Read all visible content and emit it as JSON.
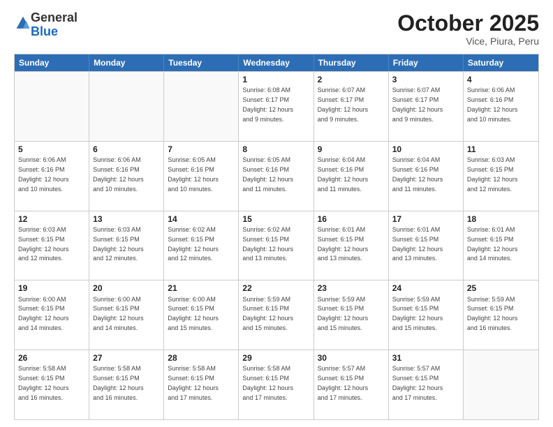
{
  "header": {
    "logo_general": "General",
    "logo_blue": "Blue",
    "month": "October 2025",
    "location": "Vice, Piura, Peru"
  },
  "days_of_week": [
    "Sunday",
    "Monday",
    "Tuesday",
    "Wednesday",
    "Thursday",
    "Friday",
    "Saturday"
  ],
  "weeks": [
    [
      {
        "day": "",
        "empty": true
      },
      {
        "day": "",
        "empty": true
      },
      {
        "day": "",
        "empty": true
      },
      {
        "day": "1",
        "lines": [
          "Sunrise: 6:08 AM",
          "Sunset: 6:17 PM",
          "Daylight: 12 hours",
          "and 9 minutes."
        ]
      },
      {
        "day": "2",
        "lines": [
          "Sunrise: 6:07 AM",
          "Sunset: 6:17 PM",
          "Daylight: 12 hours",
          "and 9 minutes."
        ]
      },
      {
        "day": "3",
        "lines": [
          "Sunrise: 6:07 AM",
          "Sunset: 6:17 PM",
          "Daylight: 12 hours",
          "and 9 minutes."
        ]
      },
      {
        "day": "4",
        "lines": [
          "Sunrise: 6:06 AM",
          "Sunset: 6:16 PM",
          "Daylight: 12 hours",
          "and 10 minutes."
        ]
      }
    ],
    [
      {
        "day": "5",
        "lines": [
          "Sunrise: 6:06 AM",
          "Sunset: 6:16 PM",
          "Daylight: 12 hours",
          "and 10 minutes."
        ]
      },
      {
        "day": "6",
        "lines": [
          "Sunrise: 6:06 AM",
          "Sunset: 6:16 PM",
          "Daylight: 12 hours",
          "and 10 minutes."
        ]
      },
      {
        "day": "7",
        "lines": [
          "Sunrise: 6:05 AM",
          "Sunset: 6:16 PM",
          "Daylight: 12 hours",
          "and 10 minutes."
        ]
      },
      {
        "day": "8",
        "lines": [
          "Sunrise: 6:05 AM",
          "Sunset: 6:16 PM",
          "Daylight: 12 hours",
          "and 11 minutes."
        ]
      },
      {
        "day": "9",
        "lines": [
          "Sunrise: 6:04 AM",
          "Sunset: 6:16 PM",
          "Daylight: 12 hours",
          "and 11 minutes."
        ]
      },
      {
        "day": "10",
        "lines": [
          "Sunrise: 6:04 AM",
          "Sunset: 6:16 PM",
          "Daylight: 12 hours",
          "and 11 minutes."
        ]
      },
      {
        "day": "11",
        "lines": [
          "Sunrise: 6:03 AM",
          "Sunset: 6:15 PM",
          "Daylight: 12 hours",
          "and 12 minutes."
        ]
      }
    ],
    [
      {
        "day": "12",
        "lines": [
          "Sunrise: 6:03 AM",
          "Sunset: 6:15 PM",
          "Daylight: 12 hours",
          "and 12 minutes."
        ]
      },
      {
        "day": "13",
        "lines": [
          "Sunrise: 6:03 AM",
          "Sunset: 6:15 PM",
          "Daylight: 12 hours",
          "and 12 minutes."
        ]
      },
      {
        "day": "14",
        "lines": [
          "Sunrise: 6:02 AM",
          "Sunset: 6:15 PM",
          "Daylight: 12 hours",
          "and 12 minutes."
        ]
      },
      {
        "day": "15",
        "lines": [
          "Sunrise: 6:02 AM",
          "Sunset: 6:15 PM",
          "Daylight: 12 hours",
          "and 13 minutes."
        ]
      },
      {
        "day": "16",
        "lines": [
          "Sunrise: 6:01 AM",
          "Sunset: 6:15 PM",
          "Daylight: 12 hours",
          "and 13 minutes."
        ]
      },
      {
        "day": "17",
        "lines": [
          "Sunrise: 6:01 AM",
          "Sunset: 6:15 PM",
          "Daylight: 12 hours",
          "and 13 minutes."
        ]
      },
      {
        "day": "18",
        "lines": [
          "Sunrise: 6:01 AM",
          "Sunset: 6:15 PM",
          "Daylight: 12 hours",
          "and 14 minutes."
        ]
      }
    ],
    [
      {
        "day": "19",
        "lines": [
          "Sunrise: 6:00 AM",
          "Sunset: 6:15 PM",
          "Daylight: 12 hours",
          "and 14 minutes."
        ]
      },
      {
        "day": "20",
        "lines": [
          "Sunrise: 6:00 AM",
          "Sunset: 6:15 PM",
          "Daylight: 12 hours",
          "and 14 minutes."
        ]
      },
      {
        "day": "21",
        "lines": [
          "Sunrise: 6:00 AM",
          "Sunset: 6:15 PM",
          "Daylight: 12 hours",
          "and 15 minutes."
        ]
      },
      {
        "day": "22",
        "lines": [
          "Sunrise: 5:59 AM",
          "Sunset: 6:15 PM",
          "Daylight: 12 hours",
          "and 15 minutes."
        ]
      },
      {
        "day": "23",
        "lines": [
          "Sunrise: 5:59 AM",
          "Sunset: 6:15 PM",
          "Daylight: 12 hours",
          "and 15 minutes."
        ]
      },
      {
        "day": "24",
        "lines": [
          "Sunrise: 5:59 AM",
          "Sunset: 6:15 PM",
          "Daylight: 12 hours",
          "and 15 minutes."
        ]
      },
      {
        "day": "25",
        "lines": [
          "Sunrise: 5:59 AM",
          "Sunset: 6:15 PM",
          "Daylight: 12 hours",
          "and 16 minutes."
        ]
      }
    ],
    [
      {
        "day": "26",
        "lines": [
          "Sunrise: 5:58 AM",
          "Sunset: 6:15 PM",
          "Daylight: 12 hours",
          "and 16 minutes."
        ]
      },
      {
        "day": "27",
        "lines": [
          "Sunrise: 5:58 AM",
          "Sunset: 6:15 PM",
          "Daylight: 12 hours",
          "and 16 minutes."
        ]
      },
      {
        "day": "28",
        "lines": [
          "Sunrise: 5:58 AM",
          "Sunset: 6:15 PM",
          "Daylight: 12 hours",
          "and 17 minutes."
        ]
      },
      {
        "day": "29",
        "lines": [
          "Sunrise: 5:58 AM",
          "Sunset: 6:15 PM",
          "Daylight: 12 hours",
          "and 17 minutes."
        ]
      },
      {
        "day": "30",
        "lines": [
          "Sunrise: 5:57 AM",
          "Sunset: 6:15 PM",
          "Daylight: 12 hours",
          "and 17 minutes."
        ]
      },
      {
        "day": "31",
        "lines": [
          "Sunrise: 5:57 AM",
          "Sunset: 6:15 PM",
          "Daylight: 12 hours",
          "and 17 minutes."
        ]
      },
      {
        "day": "",
        "empty": true
      }
    ]
  ]
}
